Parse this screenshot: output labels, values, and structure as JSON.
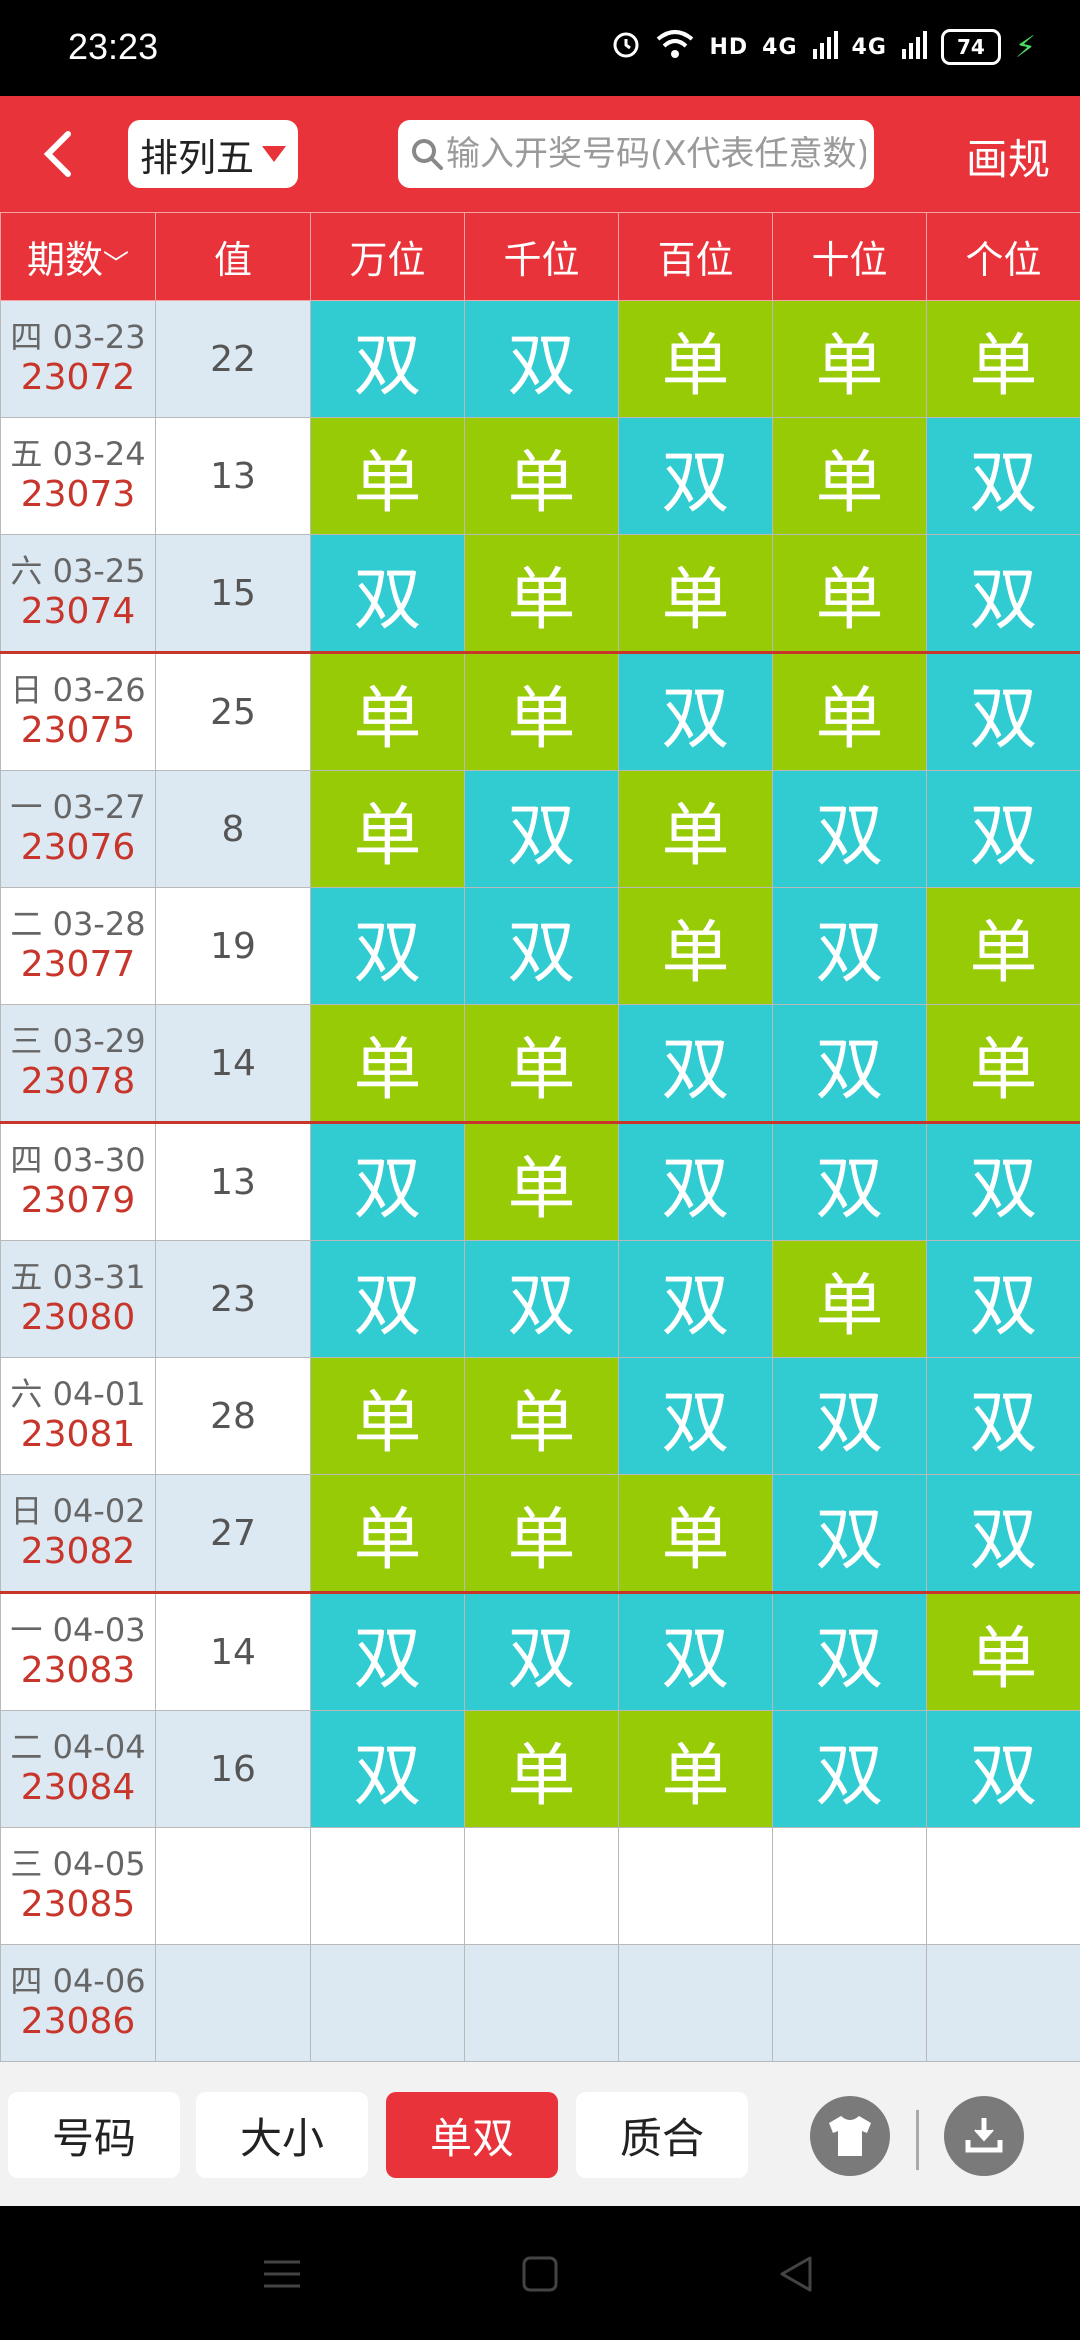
{
  "status_bar": {
    "time": "23:23",
    "network": "HD",
    "signal_1": "4G",
    "signal_2": "4G",
    "battery": "74"
  },
  "header": {
    "lottery": "排列五",
    "search_placeholder": "输入开奖号码(X代表任意数)",
    "draw_label": "画规"
  },
  "table": {
    "columns": [
      "期数",
      "值",
      "万位",
      "千位",
      "百位",
      "十位",
      "个位"
    ],
    "rows": [
      {
        "date": "四 03-23",
        "period": "23072",
        "value": "22",
        "cells": [
          "双",
          "双",
          "单",
          "单",
          "单"
        ]
      },
      {
        "date": "五 03-24",
        "period": "23073",
        "value": "13",
        "cells": [
          "单",
          "单",
          "双",
          "单",
          "双"
        ]
      },
      {
        "date": "六 03-25",
        "period": "23074",
        "value": "15",
        "cells": [
          "双",
          "单",
          "单",
          "单",
          "双"
        ]
      },
      {
        "date": "日 03-26",
        "period": "23075",
        "value": "25",
        "cells": [
          "单",
          "单",
          "双",
          "单",
          "双"
        ]
      },
      {
        "date": "一 03-27",
        "period": "23076",
        "value": "8",
        "cells": [
          "单",
          "双",
          "单",
          "双",
          "双"
        ]
      },
      {
        "date": "二 03-28",
        "period": "23077",
        "value": "19",
        "cells": [
          "双",
          "双",
          "单",
          "双",
          "单"
        ]
      },
      {
        "date": "三 03-29",
        "period": "23078",
        "value": "14",
        "cells": [
          "单",
          "单",
          "双",
          "双",
          "单"
        ]
      },
      {
        "date": "四 03-30",
        "period": "23079",
        "value": "13",
        "cells": [
          "双",
          "单",
          "双",
          "双",
          "双"
        ]
      },
      {
        "date": "五 03-31",
        "period": "23080",
        "value": "23",
        "cells": [
          "双",
          "双",
          "双",
          "单",
          "双"
        ]
      },
      {
        "date": "六 04-01",
        "period": "23081",
        "value": "28",
        "cells": [
          "单",
          "单",
          "双",
          "双",
          "双"
        ]
      },
      {
        "date": "日 04-02",
        "period": "23082",
        "value": "27",
        "cells": [
          "单",
          "单",
          "单",
          "双",
          "双"
        ]
      },
      {
        "date": "一 04-03",
        "period": "23083",
        "value": "14",
        "cells": [
          "双",
          "双",
          "双",
          "双",
          "单"
        ]
      },
      {
        "date": "二 04-04",
        "period": "23084",
        "value": "16",
        "cells": [
          "双",
          "单",
          "单",
          "双",
          "双"
        ]
      },
      {
        "date": "三 04-05",
        "period": "23085",
        "value": "",
        "cells": [
          "",
          "",
          "",
          "",
          ""
        ]
      },
      {
        "date": "四 04-06",
        "period": "23086",
        "value": "",
        "cells": [
          "",
          "",
          "",
          "",
          ""
        ]
      }
    ]
  },
  "bottom_tabs": [
    {
      "label": "号码",
      "active": false
    },
    {
      "label": "大小",
      "active": false
    },
    {
      "label": "单双",
      "active": true
    },
    {
      "label": "质合",
      "active": false
    }
  ],
  "icons": [
    "tshirt-icon",
    "download-icon"
  ],
  "colors": {
    "accent": "#e8333a",
    "odd": "#97cb06",
    "even": "#30ccd1",
    "period_number": "#c8352b"
  }
}
